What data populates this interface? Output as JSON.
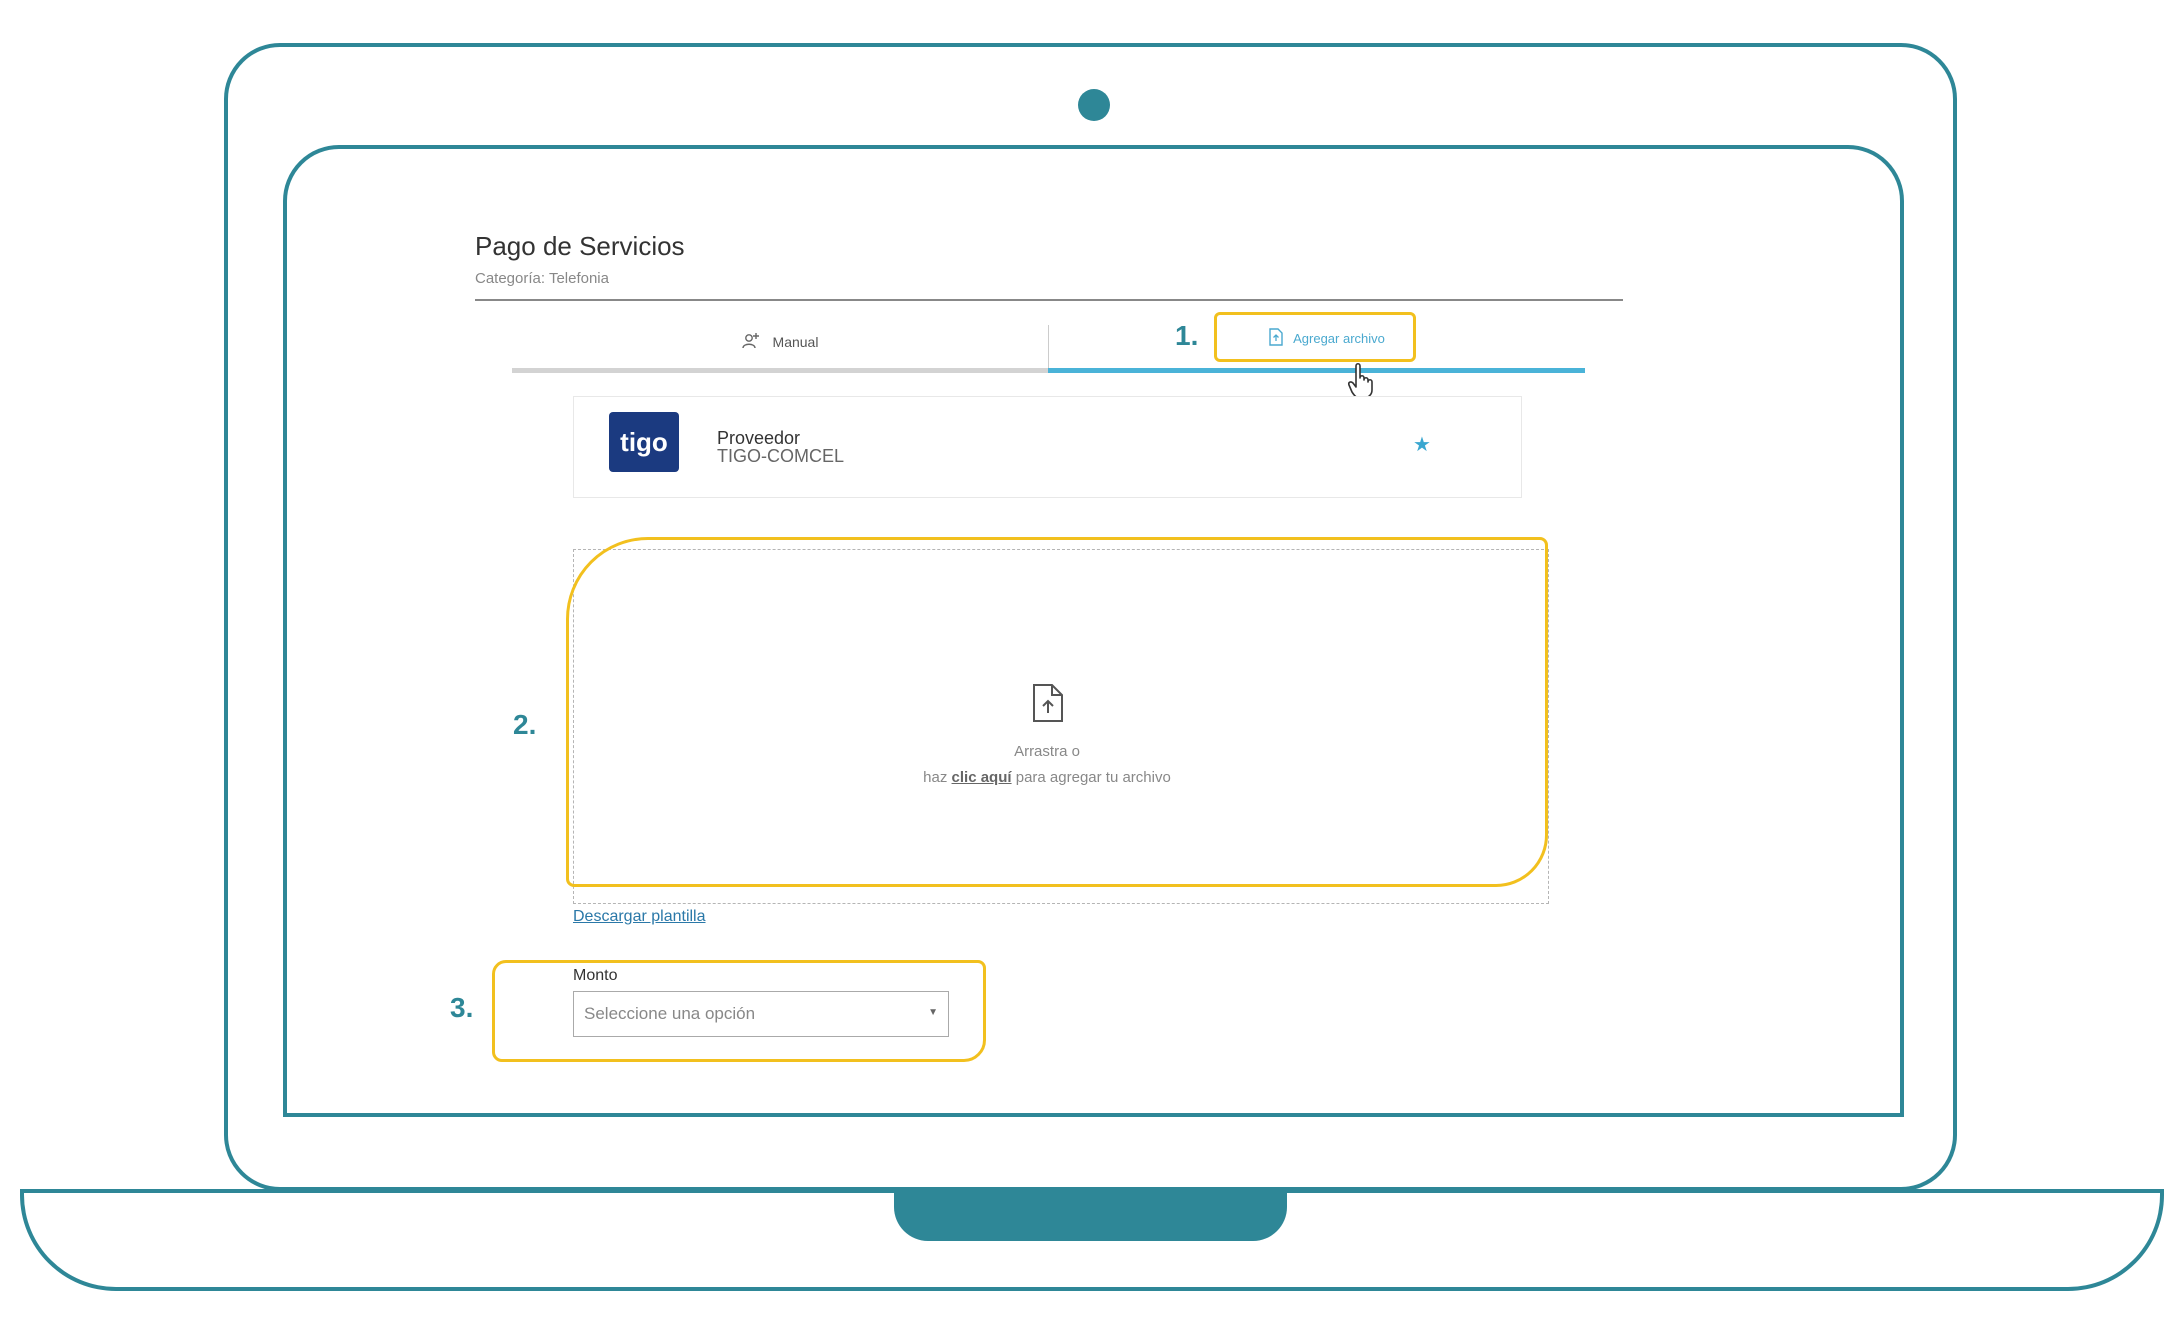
{
  "page": {
    "title": "Pago de Servicios",
    "subtitle": "Categoría: Telefonia"
  },
  "tabs": [
    {
      "label": "Manual",
      "icon": "user-add-icon",
      "active": false
    },
    {
      "label": "Agregar archivo",
      "icon": "file-icon",
      "active": true
    }
  ],
  "markers": [
    "1.",
    "2.",
    "3."
  ],
  "provider": {
    "logo_text": "tigo",
    "label": "Proveedor",
    "name": "TIGO-COMCEL",
    "favorite_icon": "star-icon"
  },
  "dropzone": {
    "line1": "Arrastra o",
    "line2_prefix": "haz ",
    "line2_link": "clic aquí",
    "line2_suffix": " para agregar tu archivo",
    "icon": "file-upload-icon"
  },
  "download_template": "Descargar plantilla",
  "monto": {
    "label": "Monto",
    "placeholder": "Seleccione una opción"
  },
  "colors": {
    "laptop": "#2e8797",
    "highlight": "#f2c01e",
    "active_tab": "#4ab3d8",
    "tigo_brand": "#1b3a80"
  }
}
